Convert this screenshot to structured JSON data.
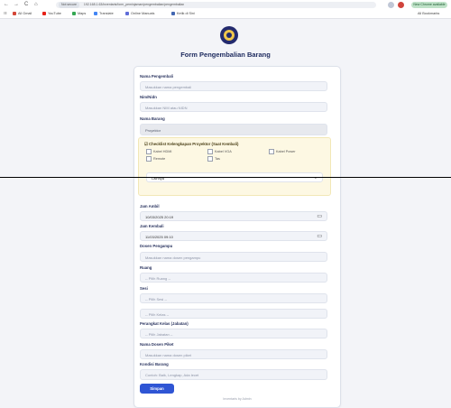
{
  "browser": {
    "back": "←",
    "forward": "→",
    "reload": "C",
    "home": "⌂",
    "not_secure": "Not secure",
    "url": "192.168.1.63/inventaris/form_peminjaman/pengembalian/pengembalian",
    "update_label": "New Chrome available",
    "apps_icon": "☷",
    "bookmarks": [
      {
        "label": "All Gmail",
        "color": "#d44638"
      },
      {
        "label": "YouTube",
        "color": "#e62117"
      },
      {
        "label": "Maps",
        "color": "#34a853"
      },
      {
        "label": "Translate",
        "color": "#4285f4"
      },
      {
        "label": "Online Manuals",
        "color": "#5f6dd8"
      },
      {
        "label": "Ketik di Sini",
        "color": "#4267b2"
      }
    ],
    "all_bookmarks": "All Bookmarks"
  },
  "page": {
    "title": "Form Pengembalian Barang"
  },
  "form": {
    "nama_pengembali": {
      "label": "Nama Pengembali",
      "placeholder": "Masukkan nama pengembali"
    },
    "nim_nidn": {
      "label": "Nim/Nidn",
      "placeholder": "Masukkan NIM atau NIDN"
    },
    "nama_barang": {
      "label": "Nama Barang",
      "value": "Proyektor"
    },
    "checklist": {
      "title": "Checklist Kelengkapan Proyektor (Saat Kembali)",
      "items": [
        "Kabel HDMI",
        "Kabel VGA",
        "Kabel Power",
        "Remote",
        "Tas"
      ]
    },
    "kondisi": {
      "value": "Lainnya",
      "chevron": "⌄"
    },
    "jam_ambil": {
      "label": "Jam Ambil",
      "value": "10/03/2025 20:19",
      "icon": "▭"
    },
    "jam_kembali": {
      "label": "Jam Kembali",
      "value": "11/03/2025 09:10",
      "icon": "▭"
    },
    "dosen_pengampu": {
      "label": "Dosen Pengampu",
      "placeholder": "Masukkan nama dosen pengampu"
    },
    "ruang": {
      "label": "Ruang",
      "value": "-- Pilih Ruang --"
    },
    "sesi": {
      "label": "Sesi",
      "value": "-- Pilih Sesi --"
    },
    "kelas": {
      "value": "-- Pilih Kelas --"
    },
    "perangkat": {
      "label": "Perangkat Kelas (Jabatan)",
      "value": "-- Pilih Jabatan --"
    },
    "nama_dosen_piket": {
      "label": "Nama Dosen Piket",
      "placeholder": "Masukkan nama dosen piket"
    },
    "kondisi_barang": {
      "label": "Kondisi Barang",
      "placeholder": "Contoh: Baik, Lengkap, Ada lecet"
    },
    "submit": "Simpan",
    "footer": "Inventaris by Admin"
  }
}
